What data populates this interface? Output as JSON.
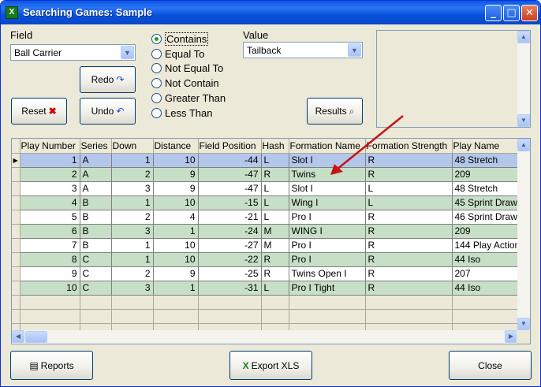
{
  "window": {
    "title": "Searching Games: Sample",
    "minimize": "_",
    "maximize": "□",
    "close": "✕"
  },
  "field": {
    "label": "Field",
    "value": "Ball Carrier"
  },
  "value": {
    "label": "Value",
    "value": "Tailback"
  },
  "buttons": {
    "redo": "Redo",
    "undo": "Undo",
    "reset": "Reset",
    "results": "Results",
    "reports": "Reports",
    "export": "Export XLS",
    "close": "Close"
  },
  "operators": [
    {
      "label": "Contains",
      "selected": true
    },
    {
      "label": "Equal To",
      "selected": false
    },
    {
      "label": "Not Equal To",
      "selected": false
    },
    {
      "label": "Not Contain",
      "selected": false
    },
    {
      "label": "Greater Than",
      "selected": false
    },
    {
      "label": "Less Than",
      "selected": false
    }
  ],
  "grid": {
    "columns": [
      "Play Number",
      "Series",
      "Down",
      "Distance",
      "Field Position",
      "Hash",
      "Formation Name",
      "Formation Strength",
      "Play Name"
    ],
    "rows": [
      [
        "1",
        "A",
        "1",
        "10",
        "-44",
        "L",
        "Slot I",
        "R",
        "48 Stretch"
      ],
      [
        "2",
        "A",
        "2",
        "9",
        "-47",
        "R",
        "Twins",
        "R",
        "209"
      ],
      [
        "3",
        "A",
        "3",
        "9",
        "-47",
        "L",
        "Slot I",
        "L",
        "48 Stretch"
      ],
      [
        "4",
        "B",
        "1",
        "10",
        "-15",
        "L",
        "Wing I",
        "L",
        "45 Sprint Draw"
      ],
      [
        "5",
        "B",
        "2",
        "4",
        "-21",
        "L",
        "Pro I",
        "R",
        "46 Sprint Draw"
      ],
      [
        "6",
        "B",
        "3",
        "1",
        "-24",
        "M",
        "WING I",
        "R",
        "209"
      ],
      [
        "7",
        "B",
        "1",
        "10",
        "-27",
        "M",
        "Pro I",
        "R",
        "144 Play Action"
      ],
      [
        "8",
        "C",
        "1",
        "10",
        "-22",
        "R",
        "Pro I",
        "R",
        "44 Iso"
      ],
      [
        "9",
        "C",
        "2",
        "9",
        "-25",
        "R",
        "Twins Open I",
        "R",
        "207"
      ],
      [
        "10",
        "C",
        "3",
        "1",
        "-31",
        "L",
        "Pro I Tight",
        "R",
        "44 Iso"
      ]
    ]
  },
  "colors": {
    "green_row": "#c6dfc6",
    "selected_row": "#b3c7ea",
    "arrow": "#c81414"
  }
}
